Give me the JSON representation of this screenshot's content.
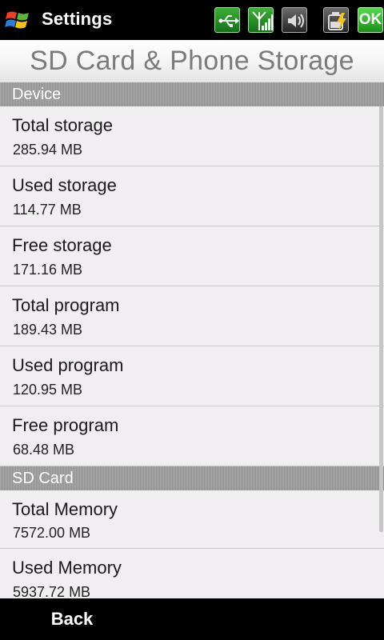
{
  "status_bar": {
    "title": "Settings",
    "ok_label": "OK",
    "icons": [
      "windows-start-icon",
      "usb-connection-icon",
      "signal-strength-icon",
      "speaker-volume-icon",
      "battery-charging-icon",
      "ok-icon"
    ]
  },
  "page_title": "SD Card & Phone Storage",
  "sections": [
    {
      "header": "Device",
      "rows": [
        {
          "label": "Total storage",
          "value": "285.94 MB"
        },
        {
          "label": "Used storage",
          "value": "114.77 MB"
        },
        {
          "label": "Free storage",
          "value": "171.16 MB"
        },
        {
          "label": "Total program",
          "value": "189.43 MB"
        },
        {
          "label": "Used program",
          "value": "120.95 MB"
        },
        {
          "label": "Free program",
          "value": "68.48 MB"
        }
      ]
    },
    {
      "header": "SD Card",
      "rows": [
        {
          "label": "Total Memory",
          "value": "7572.00 MB"
        },
        {
          "label": "Used Memory",
          "value": "5937.72 MB"
        }
      ]
    }
  ],
  "bottom_bar": {
    "back_label": "Back"
  },
  "colors": {
    "ok_green": "#2bb62b",
    "section_header_gray": "#9a9a9a",
    "list_background": "#f0eef0"
  }
}
